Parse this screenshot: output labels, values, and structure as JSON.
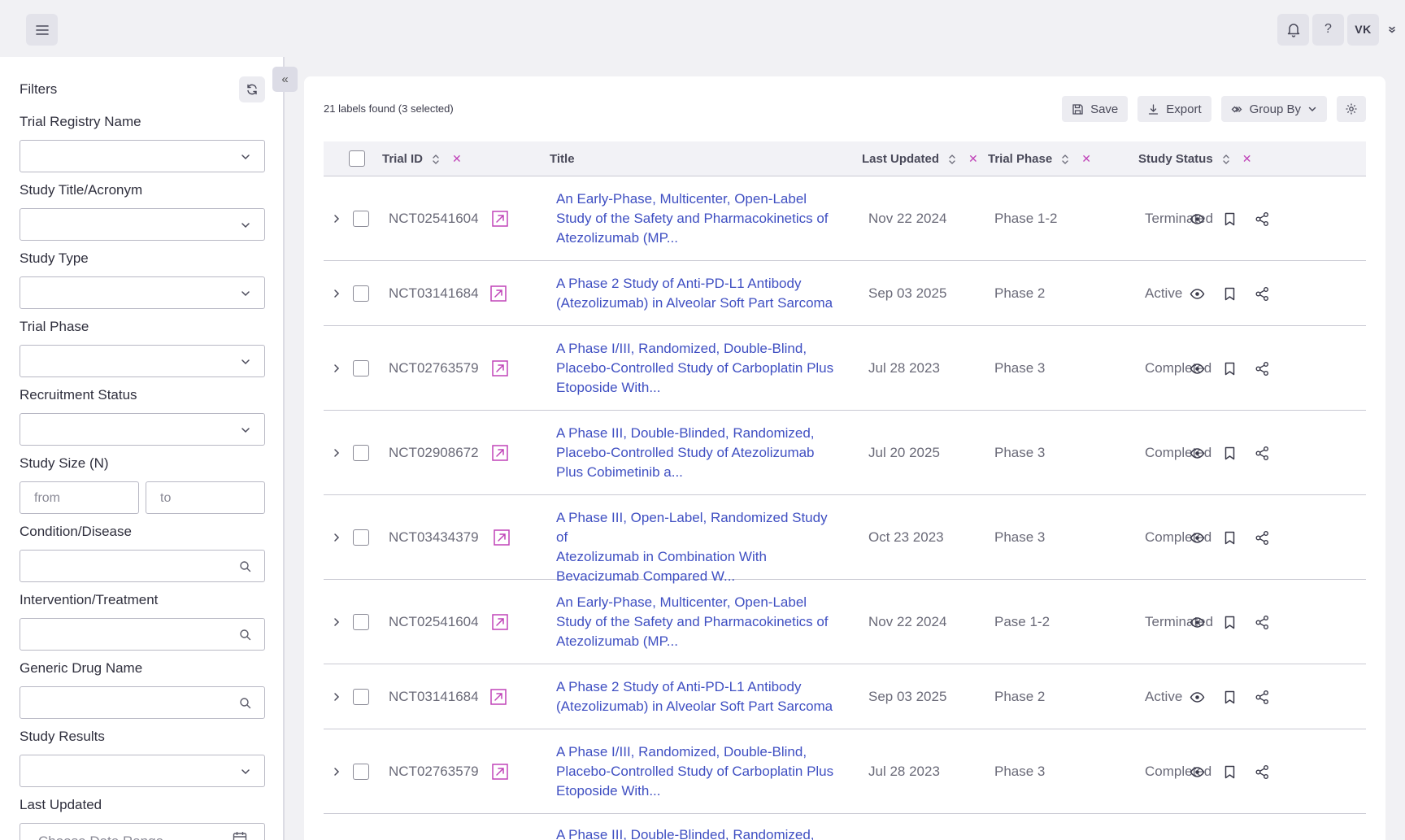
{
  "topbar": {
    "user_initials": "VK",
    "help_label": "?"
  },
  "sidebar": {
    "title": "Filters",
    "filters": {
      "trial_registry_name": "Trial Registry Name",
      "study_title": "Study Title/Acronym",
      "study_type": "Study Type",
      "trial_phase": "Trial Phase",
      "recruitment_status": "Recruitment Status",
      "study_size": "Study Size (N)",
      "condition": "Condition/Disease",
      "intervention": "Intervention/Treatment",
      "generic_drug": "Generic Drug Name",
      "study_results": "Study Results",
      "last_updated": "Last Updated"
    },
    "study_size_from_placeholder": "from",
    "study_size_to_placeholder": "to",
    "date_range_placeholder": "Choose Date Range"
  },
  "main": {
    "labels_found": "21 labels found (3 selected)",
    "toolbar": {
      "save": "Save",
      "export": "Export",
      "group_by": "Group By"
    },
    "columns": {
      "trial_id": "Trial ID",
      "title": "Title",
      "last_updated": "Last Updated",
      "trial_phase": "Trial Phase",
      "study_status": "Study Status"
    },
    "rows": [
      {
        "trial_id": "NCT02541604",
        "title_lines": [
          "An Early-Phase, Multicenter, Open-Label",
          "Study of the Safety and Pharmacokinetics of",
          "Atezolizumab (MP..."
        ],
        "last_updated": "Nov 22 2024",
        "phase": "Phase 1-2",
        "status": "Terminated"
      },
      {
        "trial_id": "NCT03141684",
        "title_lines": [
          "A Phase 2 Study of Anti-PD-L1 Antibody",
          "(Atezolizumab) in Alveolar Soft Part Sarcoma"
        ],
        "last_updated": "Sep 03 2025",
        "phase": "Phase 2",
        "status": "Active"
      },
      {
        "trial_id": "NCT02763579",
        "title_lines": [
          "A Phase I/III, Randomized, Double-Blind,",
          "Placebo-Controlled Study of Carboplatin Plus",
          "Etoposide With..."
        ],
        "last_updated": "Jul 28 2023",
        "phase": "Phase 3",
        "status": "Completed"
      },
      {
        "trial_id": "NCT02908672",
        "title_lines": [
          "A Phase III, Double-Blinded, Randomized,",
          "Placebo-Controlled Study of Atezolizumab",
          "Plus Cobimetinib a..."
        ],
        "last_updated": "Jul 20 2025",
        "phase": "Phase 3",
        "status": "Completed"
      },
      {
        "trial_id": "NCT03434379",
        "title_lines": [
          "A Phase III, Open-Label, Randomized Study of",
          "Atezolizumab in Combination With",
          "Bevacizumab Compared W..."
        ],
        "last_updated": "Oct 23 2023",
        "phase": "Phase 3",
        "status": "Completed"
      },
      {
        "trial_id": "NCT02541604",
        "title_lines": [
          "An Early-Phase, Multicenter, Open-Label",
          "Study of the Safety and Pharmacokinetics of",
          "Atezolizumab (MP..."
        ],
        "last_updated": "Nov 22 2024",
        "phase": "Pase 1-2",
        "status": "Terminated"
      },
      {
        "trial_id": "NCT03141684",
        "title_lines": [
          "A Phase 2 Study of Anti-PD-L1 Antibody",
          "(Atezolizumab) in Alveolar Soft Part Sarcoma"
        ],
        "last_updated": "Sep 03 2025",
        "phase": "Phase 2",
        "status": "Active"
      },
      {
        "trial_id": "NCT02763579",
        "title_lines": [
          "A Phase I/III, Randomized, Double-Blind,",
          "Placebo-Controlled Study of Carboplatin Plus",
          "Etoposide With..."
        ],
        "last_updated": "Jul 28 2023",
        "phase": "Phase 3",
        "status": "Completed"
      },
      {
        "trial_id": "",
        "title_lines": [
          "A Phase III, Double-Blinded, Randomized,"
        ],
        "last_updated": "",
        "phase": "",
        "status": ""
      }
    ]
  },
  "colors": {
    "accent_link": "#3f4fc2",
    "accent_magenta": "#c044b8",
    "page_bg": "#f1f1f4"
  },
  "icons": {
    "menu": "hamburger-menu-icon",
    "bell": "bell-icon",
    "refresh": "refresh-icon",
    "collapse": "double-chevron-left-icon",
    "row_actions": [
      "eye-icon",
      "bookmark-icon",
      "share-icon"
    ],
    "external": "external-link-icon"
  }
}
